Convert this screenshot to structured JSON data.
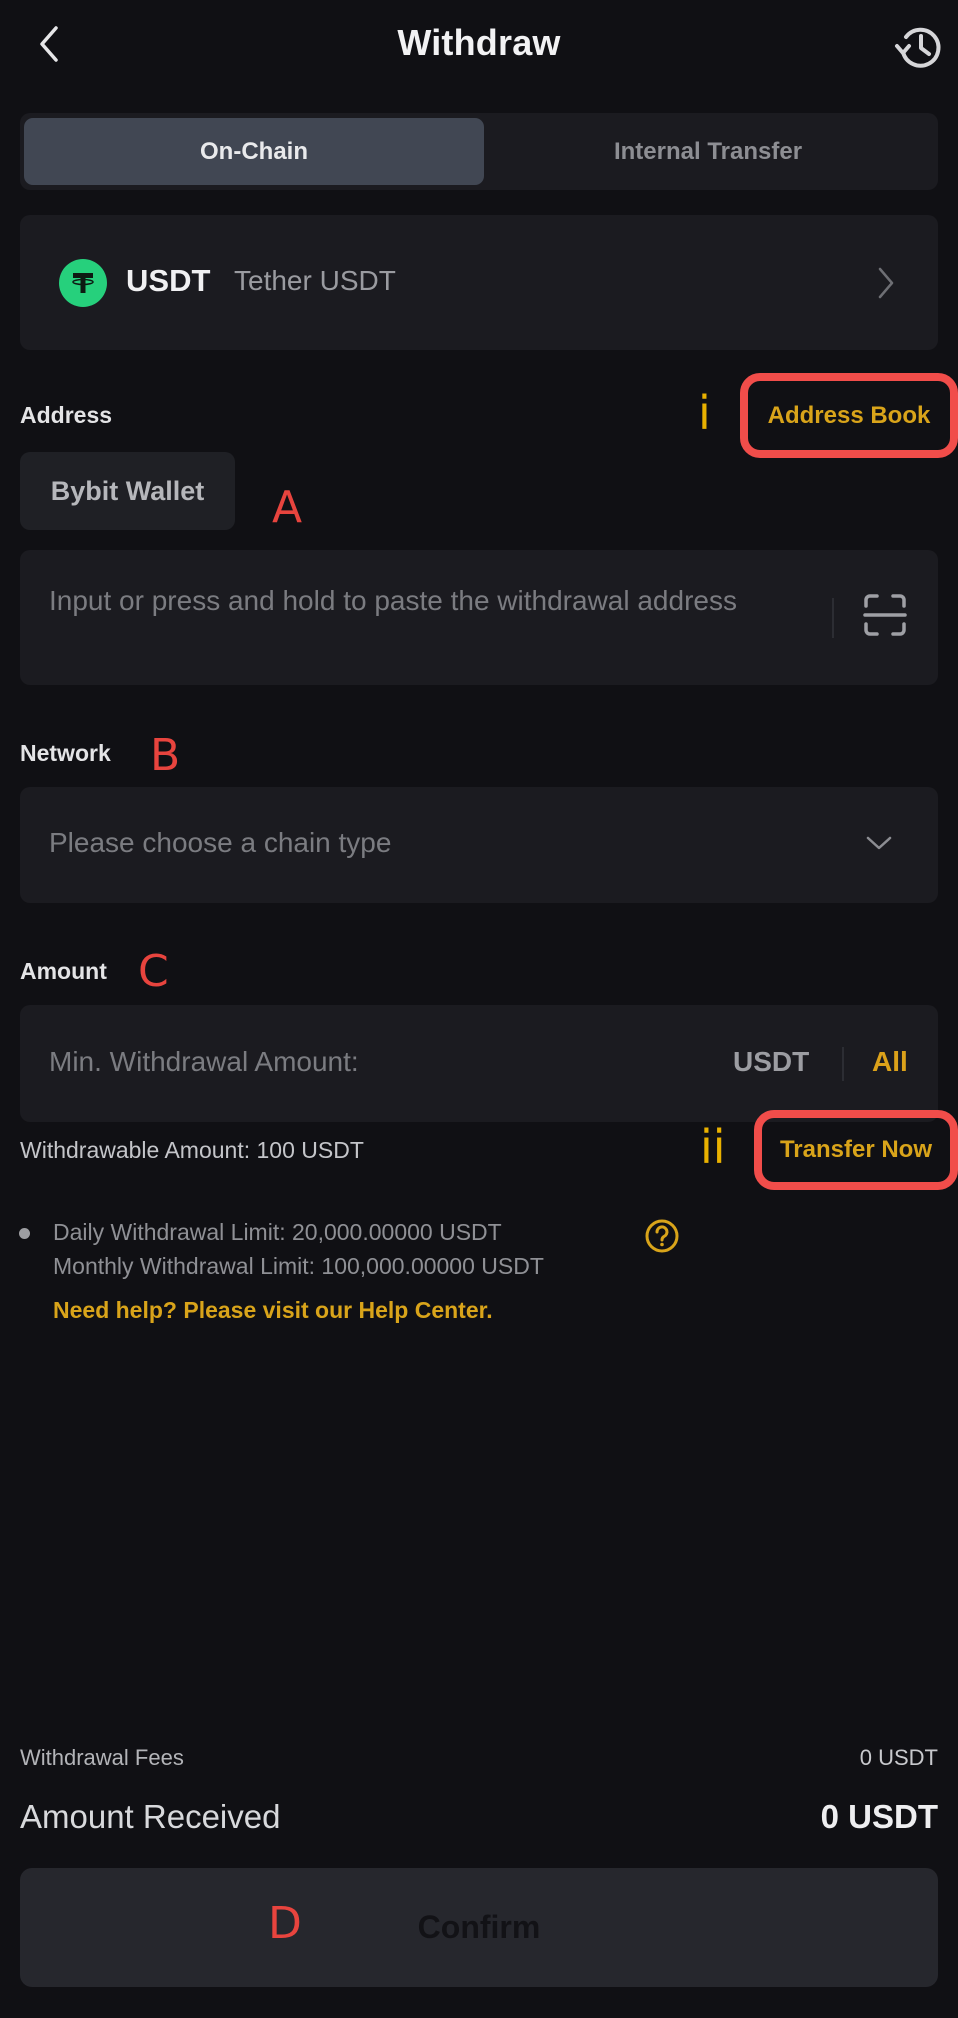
{
  "header": {
    "title": "Withdraw",
    "back_icon": "chevron-left-icon",
    "history_icon": "history-icon"
  },
  "tabs": [
    {
      "label": "On-Chain",
      "active": true
    },
    {
      "label": "Internal Transfer",
      "active": false
    }
  ],
  "coin": {
    "symbol": "USDT",
    "name": "Tether USDT",
    "icon": "tether-icon",
    "icon_glyph": "T",
    "icon_color": "#26d07c"
  },
  "address": {
    "label": "Address",
    "address_book_label": "Address Book",
    "wallet_chip": "Bybit Wallet",
    "placeholder": "Input or press and hold to paste the withdrawal address",
    "scan_icon": "scan-icon"
  },
  "network": {
    "label": "Network",
    "placeholder": "Please choose a chain type"
  },
  "amount": {
    "label": "Amount",
    "placeholder": "Min. Withdrawal Amount:",
    "unit": "USDT",
    "all_label": "All",
    "withdrawable": "Withdrawable Amount: 100 USDT",
    "transfer_label": "Transfer Now"
  },
  "limits": {
    "daily": "Daily Withdrawal Limit: 20,000.00000 USDT",
    "monthly": "Monthly Withdrawal Limit: 100,000.00000 USDT",
    "help_link": "Need help? Please visit our Help Center."
  },
  "summary": {
    "fees_label": "Withdrawal Fees",
    "fees_value": "0 USDT",
    "received_label": "Amount Received",
    "received_value": "0 USDT"
  },
  "confirm_label": "Confirm",
  "annotations": {
    "i": "i",
    "ii": "ii",
    "A": "A",
    "B": "B",
    "C": "C",
    "D": "D"
  },
  "colors": {
    "background": "#101014",
    "card": "#1b1b20",
    "accent": "#d9a41a",
    "highlight_box": "#f14d4a",
    "annotation_red": "#e8443e",
    "annotation_yellow": "#e9b100"
  }
}
